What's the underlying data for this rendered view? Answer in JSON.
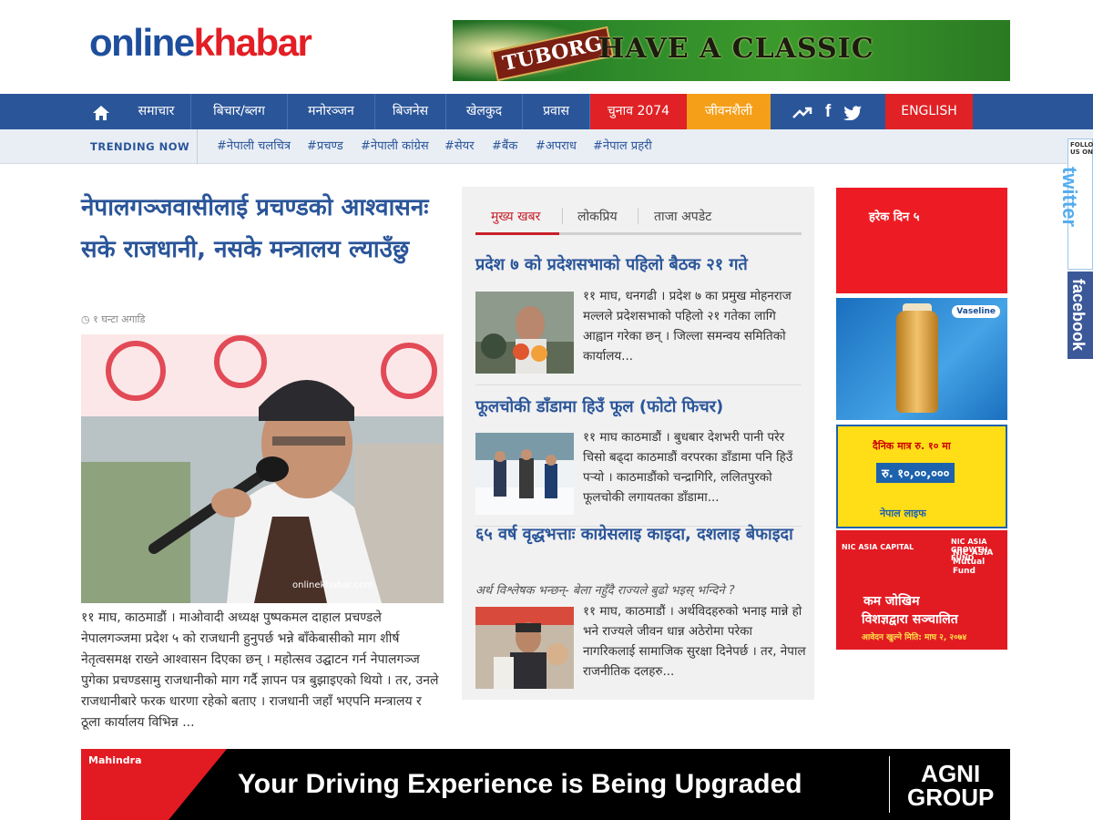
{
  "header": {
    "logo_part1": "online",
    "logo_part2": "khabar",
    "top_ad": {
      "brand": "TUBORG",
      "tagline": "HAVE A CLASSIC"
    }
  },
  "nav": {
    "items": [
      {
        "label": "समाचार"
      },
      {
        "label": "बिचार/ब्लग"
      },
      {
        "label": "मनोरञ्जन"
      },
      {
        "label": "बिजनेस"
      },
      {
        "label": "खेलकुद"
      },
      {
        "label": "प्रवास"
      },
      {
        "label": "चुनाव 2074"
      },
      {
        "label": "जीवनशैली"
      },
      {
        "label": "ENGLISH"
      }
    ]
  },
  "trending": {
    "label": "TRENDING NOW",
    "tags": [
      "#नेपाली चलचित्र",
      "#प्रचण्ड",
      "#नेपाली कांग्रेस",
      "#सेयर",
      "#बैंक",
      "#अपराध",
      "#नेपाल प्रहरी"
    ]
  },
  "lead": {
    "title": "नेपालगञ्जवासीलाई प्रचण्डको आश्वासनः सके राजधानी, नसके मन्त्रालय ल्याउँछु",
    "time": "१ घन्टा अगाडि",
    "image_watermark": "onlinekhabar.com",
    "excerpt": "११ माघ, काठमाडौं । माओवादी अध्यक्ष पुष्पकमल दाहाल प्रचण्डले नेपालगञ्जमा प्रदेश ५ को राजधानी हुनुपर्छ भन्ने बाँकेबासीको माग शीर्ष नेतृत्वसमक्ष राख्ने आश्वासन दिएका छन् । महोत्सव उद्घाटन गर्न नेपालगञ्ज पुगेका प्रचण्डसामु राजधानीको माग गर्दै ज्ञापन पत्र बुझाइएको थियो । तर, उनले राजधानीबारे फरक धारणा रहेको बताए । राजधानी जहाँ भएपनि मन्त्रालय र ठूला कार्यालय विभिन्न ..."
  },
  "tabs": [
    {
      "label": "मुख्य खबर"
    },
    {
      "label": "लोकप्रिय"
    },
    {
      "label": "ताजा अपडेट"
    }
  ],
  "stories": [
    {
      "title": "प्रदेश ७ को प्रदेशसभाको पहिलो बैठक २१ गते",
      "text": "११ माघ, धनगढी । प्रदेश ७ का प्रमुख मोहनराज मल्लले प्रदेशसभाको पहिलो २१ गतेका लागि आह्वान गरेका छन् । जिल्ला समन्वय समितिको कार्यालय..."
    },
    {
      "title": "फूलचोकी डाँडामा हिउँ फूल (फोटो फिचर)",
      "text": "११ माघ काठमाडौं । बुधबार देशभरी पानी परेर चिसो बढ्दा काठमाडौं वरपरका डाँडामा पनि हिउँ पर्‍यो । काठमाडौंको चन्द्रागिरि, ललितपुरको फूलचोकी लगायतका डाँडामा..."
    },
    {
      "title": "६५ वर्ष वृद्धभत्ताः काग्रेसलाइ काइदा, दशलाइ बेफाइदा",
      "subtitle": "अर्थ विश्लेषक भन्छन्- बेला नहुँदै राज्यले बुढो भइस् भन्दिने ?",
      "text": "११ माघ, काठमाडौं । अर्थविदहरुको भनाइ मान्ने हो भने राज्यले जीवन धान्न अठेरोमा परेका नागरिकलाई सामाजिक सुरक्षा दिनेपर्छ । तर, नेपाल राजनीतिक दलहरु..."
    }
  ],
  "sidebar_ads": {
    "red_text": "हरेक दिन ५",
    "vaseline_badge": "Vaseline",
    "life_line1": "दैनिक मात्र रु. १० मा",
    "life_line2": "रु. १०,००,०००",
    "life_line3": "नेपाल लाइफ",
    "nic_capital": "NIC ASIA CAPITAL",
    "nic_fund_tag": "NIC ASIA GROWTH FUND",
    "nic_fund_name": "NIC ASIA Mutual Fund",
    "nic_slogan1": "कम जोखिम",
    "nic_slogan2": "विशज्ञद्वारा सञ्चालित",
    "nic_deadline": "आवेदन खुल्ने मिति: माघ २, २०७४"
  },
  "social": {
    "follow": "FOLLOW US ON",
    "twitter": "twitter",
    "facebook": "facebook"
  },
  "bottom_ad": {
    "brand": "Mahindra",
    "tagline": "Your Driving Experience is Being Upgraded",
    "agni_line1": "AGNI",
    "agni_line2": "GROUP"
  },
  "colors": {
    "brand_blue": "#2a5599",
    "brand_red": "#e31e24",
    "nav_red": "#e02226",
    "nav_orange": "#f59f19"
  }
}
